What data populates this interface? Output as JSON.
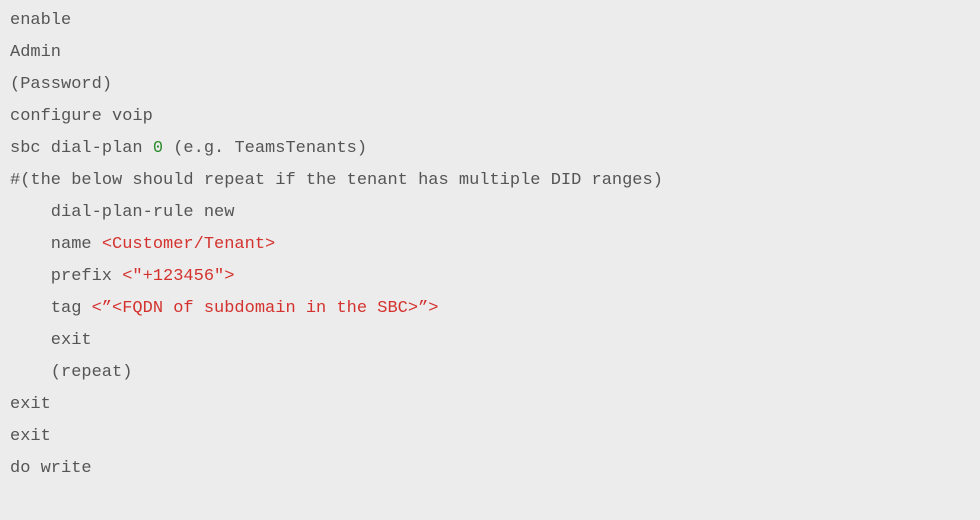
{
  "code": {
    "l1": "enable",
    "l2": "Admin",
    "l3": "(Password)",
    "l4": "configure voip",
    "l5a": "sbc dial-plan ",
    "l5num": "0",
    "l5b": " (e.g. TeamsTenants)",
    "l6": "#(the below should repeat if the tenant has multiple DID ranges)",
    "l7": "dial-plan-rule new",
    "l8a": "name ",
    "l8red": "<Customer/Tenant>",
    "l9a": "prefix ",
    "l9red": "<\"+123456\">",
    "l10a": "tag ",
    "l10red": "<”<FQDN of subdomain in the SBC>”>",
    "l11": "exit",
    "l12": "(repeat)",
    "l13": "exit",
    "l14": "exit",
    "l15": "do write"
  }
}
